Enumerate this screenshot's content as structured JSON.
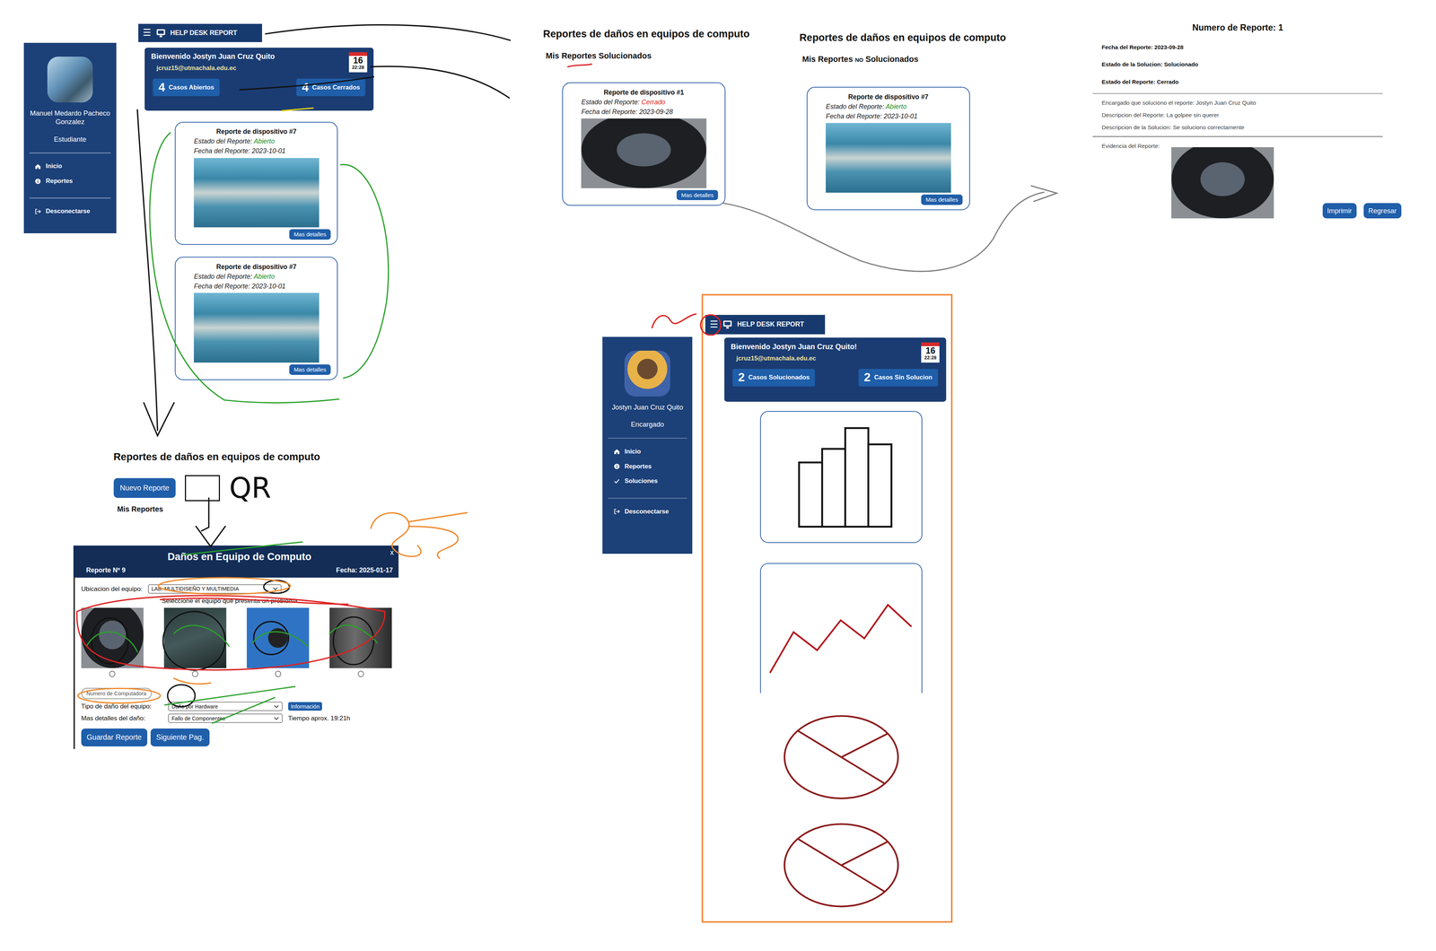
{
  "student": {
    "header": {
      "menu": "☰",
      "title": "HELP DESK REPORT"
    },
    "sidebar": {
      "name": "Manuel Medardo Pacheco Gonzalez",
      "role": "Estudiante",
      "items": [
        {
          "kind": "home",
          "label": "Inicio"
        },
        {
          "kind": "info",
          "label": "Reportes"
        }
      ],
      "logout": {
        "kind": "logout",
        "label": "Desconectarse"
      }
    },
    "welcome": {
      "greeting": "Bienvenido Jostyn Juan Cruz Quito",
      "email": "jcruz15@utmachala.edu.ec",
      "day": "16",
      "time": "22:28",
      "counters": [
        {
          "count": "4",
          "label": "Casos Abiertos"
        },
        {
          "count": "4",
          "label": "Casos Cerrados"
        }
      ]
    },
    "cards": [
      {
        "title": "Reporte de dispositivo #7",
        "status_label": "Estado del Reporte:",
        "status": "Abierto",
        "color": "#1e8c1e",
        "date_label": "Fecha del Reporte:",
        "date": "2023-10-01",
        "kind": "board",
        "button": "Mas detalles"
      },
      {
        "title": "Reporte de dispositivo #7",
        "status_label": "Estado del Reporte:",
        "status": "Abierto",
        "color": "#1e8c1e",
        "date_label": "Fecha del Reporte:",
        "date": "2023-10-01",
        "kind": "board",
        "button": "Mas detalles"
      }
    ]
  },
  "new_report_page": {
    "title": "Reportes de daños en equipos de computo",
    "new_button": "Nuevo Reporte",
    "subtitle": "Mis Reportes",
    "sketch_label": "QR"
  },
  "modal": {
    "title": "Daños en Equipo de Computo",
    "number": "Reporte Nº 9",
    "date": "Fecha: 2025-01-17",
    "close": "x",
    "location_label": "Ubicacion del equipo:",
    "location": "LAB. MULTIDISEÑO Y MULTIMEDIA",
    "equipment_prompt": "Seleccione el equipo que presenta un problema",
    "equipment": [
      {
        "kind": "monitor",
        "selected": false
      },
      {
        "kind": "keyboard",
        "selected": false
      },
      {
        "kind": "mouse",
        "selected": false
      },
      {
        "kind": "cpu",
        "selected": false
      }
    ],
    "computer_number_placeholder": "Numero de Computadora",
    "damage_type_label": "Tipo de daño del equipo:",
    "damage_type": "Daño por Hardware",
    "info_button": "Información",
    "details_label": "Mas detalles del daño:",
    "details": "Fallo de Componentes",
    "time": "Tiempo aprox. 19:21h",
    "buttons": [
      "Guardar Reporte",
      "Siguiente Pag."
    ]
  },
  "solved_page": {
    "title": "Reportes de daños en equipos de computo",
    "subtitle": "Mis Reportes Solucionados",
    "cards": [
      {
        "title": "Reporte de dispositivo #1",
        "status_label": "Estado del Reporte:",
        "status": "Cerrado",
        "color": "#d92b2b",
        "date_label": "Fecha del Reporte:",
        "date": "2023-09-28",
        "kind": "monitor",
        "button": "Mas detalles"
      }
    ]
  },
  "unsolved_page": {
    "title": "Reportes de daños en equipos de computo",
    "subtitle_before": "Mis Reportes",
    "subtitle_mark": "NO",
    "subtitle_after": "Solucionados",
    "cards": [
      {
        "title": "Reporte de dispositivo #7",
        "status_label": "Estado del Reporte:",
        "status": "Abierto",
        "color": "#1e8c1e",
        "date_label": "Fecha del Reporte:",
        "date": "2023-10-01",
        "kind": "board",
        "button": "Mas detalles"
      }
    ]
  },
  "detail": {
    "title": "Numero de Reporte: 1",
    "summary": [
      "Fecha del Reporte: 2023-09-28",
      "Estado de la Solucion: Solucionado",
      "Estado del Reporte: Cerrado"
    ],
    "info": [
      "Encargado que soluciono el reporte: Jostyn Juan Cruz Quito",
      "Descripcion del Reporte: La golpee sin querer",
      "Descripcion de la Solucion: Se soluciono correctamente"
    ],
    "evidence_label": "Evidencia del Reporte:",
    "buttons": [
      "Imprimir",
      "Regresar"
    ]
  },
  "staff": {
    "header": {
      "menu": "☰",
      "title": "HELP DESK REPORT"
    },
    "sidebar": {
      "name": "Jostyn Juan Cruz Quito",
      "role": "Encargado",
      "items": [
        {
          "kind": "home",
          "label": "Inicio"
        },
        {
          "kind": "info",
          "label": "Reportes"
        },
        {
          "kind": "check",
          "label": "Soluciones"
        }
      ],
      "logout": {
        "kind": "logout",
        "label": "Desconectarse"
      }
    },
    "welcome": {
      "greeting": "Bienvenido Jostyn Juan Cruz Quito!",
      "email": "jcruz15@utmachala.edu.ec",
      "day": "16",
      "time": "22:28",
      "counters": [
        {
          "count": "2",
          "label": "Casos Solucionados"
        },
        {
          "count": "2",
          "label": "Casos Sin Solucion"
        }
      ]
    },
    "sketches": [
      {
        "kind": "bars",
        "values": [
          71,
          86,
          109,
          91
        ]
      },
      {
        "kind": "line",
        "values": [
          10,
          55,
          35,
          68,
          48,
          85,
          61
        ]
      },
      {
        "kind": "pie",
        "values": [
          105,
          75,
          180
        ]
      },
      {
        "kind": "pie",
        "values": [
          105,
          75,
          180
        ]
      }
    ]
  }
}
